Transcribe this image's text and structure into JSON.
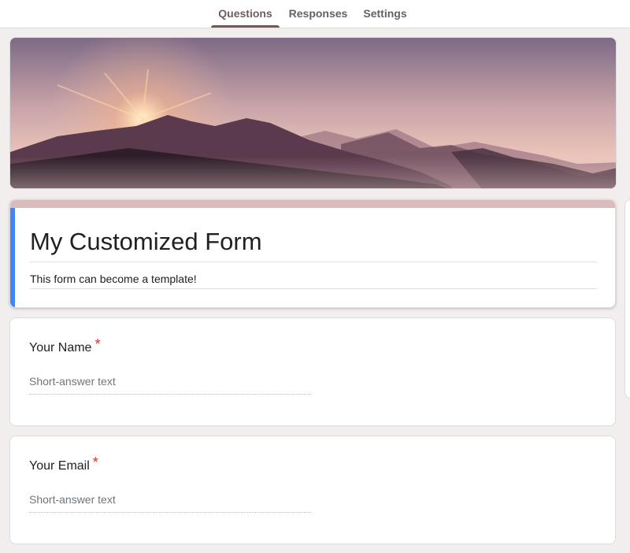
{
  "tabs": [
    {
      "label": "Questions",
      "active": true
    },
    {
      "label": "Responses",
      "active": false
    },
    {
      "label": "Settings",
      "active": false
    }
  ],
  "header_image": {
    "icon": "mountain-sunset-image"
  },
  "form": {
    "title": "My Customized Form",
    "description": "This form can become a template!"
  },
  "questions": [
    {
      "label": "Your Name",
      "required_mark": "*",
      "placeholder": "Short-answer text"
    },
    {
      "label": "Your Email",
      "required_mark": "*",
      "placeholder": "Short-answer text"
    }
  ],
  "colors": {
    "background": "#f3eeee",
    "accent": "#6e5d5d",
    "title_accent": "#dbbcbc",
    "focus_bar": "#4285f4",
    "required": "#d93025"
  }
}
